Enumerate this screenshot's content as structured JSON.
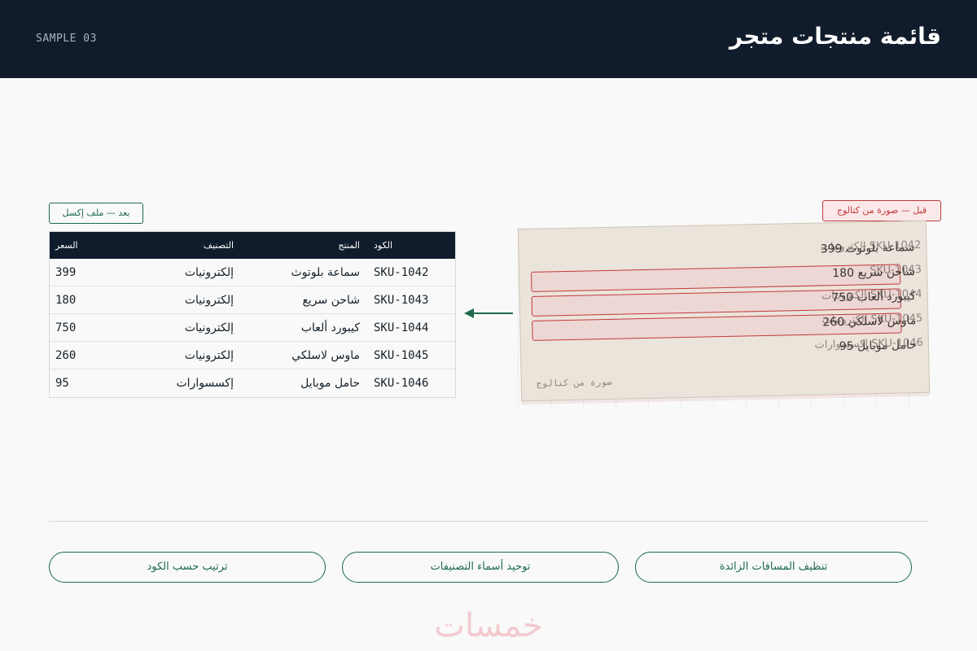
{
  "header": {
    "title": "قائمة منتجات متجر",
    "sample_label": "SAMPLE 03"
  },
  "tags": {
    "after": "بعد — ملف إكسل",
    "before": "قبل — صورة من كتالوج"
  },
  "table": {
    "columns": {
      "code": "الكود",
      "product": "المنتج",
      "category": "التصنيف",
      "price": "السعر"
    },
    "rows": [
      {
        "code": "SKU-1042",
        "product": "سماعة بلوتوث",
        "category": "إلكترونيات",
        "price": "399"
      },
      {
        "code": "SKU-1043",
        "product": "شاحن سريع",
        "category": "إلكترونيات",
        "price": "180"
      },
      {
        "code": "SKU-1044",
        "product": "كيبورد ألعاب",
        "category": "إلكترونيات",
        "price": "750"
      },
      {
        "code": "SKU-1045",
        "product": "ماوس لاسلكي",
        "category": "إلكترونيات",
        "price": "260"
      },
      {
        "code": "SKU-1046",
        "product": "حامل موبايل",
        "category": "إكسسوارات",
        "price": "95"
      }
    ]
  },
  "catalog": {
    "caption": "صورة من كتالوج",
    "lines": [
      {
        "text": "سماعة بلوتوث 399",
        "overlay": "SKU-1042 إلكترونيات"
      },
      {
        "text": "شاحن سريع 180",
        "overlay": "SKU-1043"
      },
      {
        "text": "كيبورد ألعاب 750",
        "overlay": "SKU-1044 إلكترونيات"
      },
      {
        "text": "ماوس لاسلكي 260",
        "overlay": "SKU-1045 إلكترونيات"
      },
      {
        "text": "حامل موبايل 95",
        "overlay": "SKU-1046 إكسسوارات"
      }
    ]
  },
  "actions": {
    "sort_label": "ترتيب حسب الكود",
    "unify_label": "توحيد أسماء التصنيفات",
    "clean_label": "تنظيف المسافات الزائدة"
  },
  "watermark": "خمسات",
  "colors": {
    "header_bg": "#101c2b",
    "accent_green": "#1e6a4a",
    "accent_red": "#c0393b"
  },
  "icons": {
    "arrow": "arrow-left-icon"
  }
}
